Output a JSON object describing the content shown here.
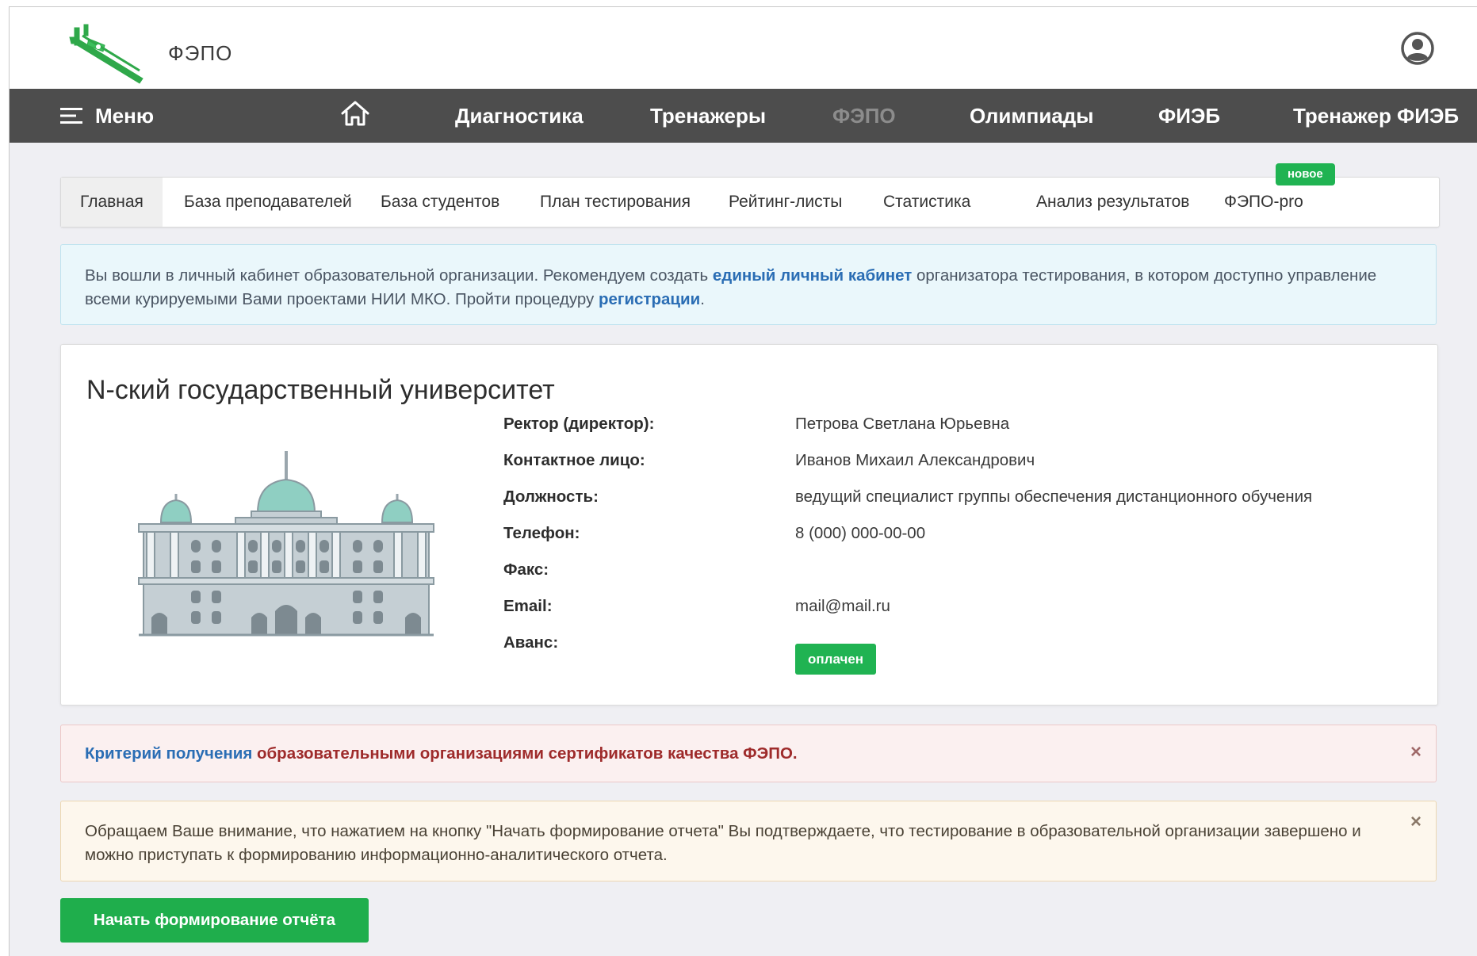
{
  "header": {
    "brand": "ФЭПО"
  },
  "navbar": {
    "menu_label": "Меню",
    "items": [
      {
        "label": "Диагностика"
      },
      {
        "label": "Тренажеры"
      },
      {
        "label": "ФЭПО",
        "active": true
      },
      {
        "label": "Олимпиады"
      },
      {
        "label": "ФИЭБ"
      },
      {
        "label": "Тренажер ФИЭБ"
      }
    ]
  },
  "tabs": {
    "items": [
      {
        "label": "Главная",
        "active": true
      },
      {
        "label": "База преподавателей"
      },
      {
        "label": "База студентов"
      },
      {
        "label": "План тестирования"
      },
      {
        "label": "Рейтинг-листы"
      },
      {
        "label": "Статистика"
      },
      {
        "label": "Анализ результатов"
      },
      {
        "label": "ФЭПО-pro"
      }
    ],
    "new_badge": "новое"
  },
  "info_alert": {
    "text_1": "Вы вошли в личный кабинет образовательной организации. Рекомендуем создать ",
    "link_1": "единый личный кабинет",
    "text_2": " организатора тестирования, в котором доступно управление всеми курируемыми Вами проектами НИИ МКО. Пройти процедуру ",
    "link_2": "регистрации",
    "text_3": "."
  },
  "org": {
    "title": "N-ский государственный университет",
    "fields": [
      {
        "label": "Ректор (директор):",
        "value": "Петрова Светлана Юрьевна"
      },
      {
        "label": "Контактное лицо:",
        "value": "Иванов Михаил Александрович"
      },
      {
        "label": "Должность:",
        "value": "ведущий специалист группы обеспечения дистанционного обучения"
      },
      {
        "label": "Телефон:",
        "value": "8 (000) 000-00-00"
      },
      {
        "label": "Факс:",
        "value": ""
      },
      {
        "label": "Email:",
        "value": "mail@mail.ru"
      },
      {
        "label": "Аванс:",
        "value": ""
      }
    ],
    "advance_status": "оплачен"
  },
  "danger_alert": {
    "link": "Критерий получения",
    "text": " образовательными организациями сертификатов качества ФЭПО."
  },
  "warning_alert": {
    "text": "Обращаем Ваше внимание, что нажатием на кнопку \"Начать формирование отчета\" Вы подтверждаете, что тестирование в образовательной организации завершено и можно приступать к формированию информационно-аналитического отчета."
  },
  "actions": {
    "start_report": "Начать формирование отчёта"
  },
  "icons": {
    "logo": "caliper-logo-icon",
    "user": "user-account-icon",
    "menu": "hamburger-menu-icon",
    "home": "home-icon",
    "close": "close-icon",
    "building": "university-building-icon"
  },
  "colors": {
    "navbar": "#4d4d4d",
    "accent_green": "#20b352",
    "link_blue": "#2a6db4",
    "danger_text": "#9e2b2b"
  }
}
